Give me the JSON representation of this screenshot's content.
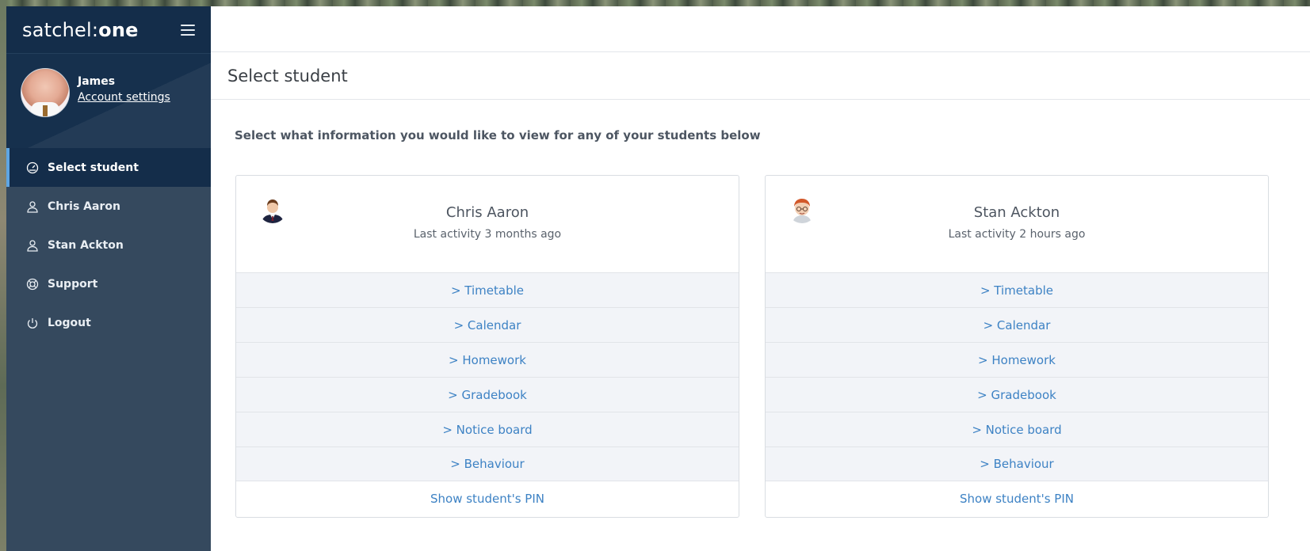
{
  "app": {
    "logo_regular": "satchel:",
    "logo_bold": "one"
  },
  "profile": {
    "name": "James",
    "account_link": "Account settings"
  },
  "sidebar": {
    "items": [
      {
        "label": "Select student",
        "icon": "dashboard-icon",
        "active": true
      },
      {
        "label": "Chris Aaron",
        "icon": "user-icon",
        "active": false
      },
      {
        "label": "Stan Ackton",
        "icon": "user-icon",
        "active": false
      },
      {
        "label": "Support",
        "icon": "lifebuoy-icon",
        "active": false
      },
      {
        "label": "Logout",
        "icon": "power-icon",
        "active": false
      }
    ]
  },
  "page": {
    "title": "Select student",
    "intro": "Select what information you would like to view for any of your students below"
  },
  "students": [
    {
      "name": "Chris Aaron",
      "activity": "Last activity 3 months ago",
      "links": [
        "> Timetable",
        "> Calendar",
        "> Homework",
        "> Gradebook",
        "> Notice board",
        "> Behaviour"
      ],
      "pin": "Show student's PIN"
    },
    {
      "name": "Stan Ackton",
      "activity": "Last activity 2 hours ago",
      "links": [
        "> Timetable",
        "> Calendar",
        "> Homework",
        "> Gradebook",
        "> Notice board",
        "> Behaviour"
      ],
      "pin": "Show student's PIN"
    }
  ],
  "colors": {
    "sidebar_bg": "#35495e",
    "sidebar_dark": "#142d4a",
    "accent": "#5ea6e4",
    "link": "#3d82c4"
  }
}
